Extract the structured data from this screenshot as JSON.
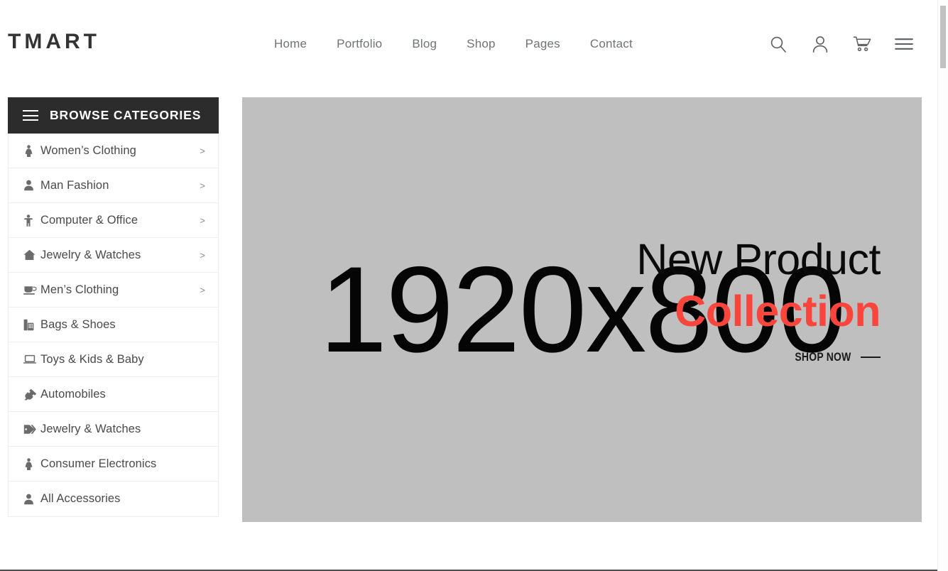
{
  "header": {
    "logo": "TMART",
    "nav": [
      {
        "label": "Home"
      },
      {
        "label": "Portfolio"
      },
      {
        "label": "Blog"
      },
      {
        "label": "Shop"
      },
      {
        "label": "Pages"
      },
      {
        "label": "Contact"
      }
    ],
    "icons": [
      {
        "name": "search-icon"
      },
      {
        "name": "user-account-icon"
      },
      {
        "name": "shopping-cart-icon"
      },
      {
        "name": "hamburger-menu-icon"
      }
    ]
  },
  "sidebar": {
    "title": "BROWSE CATEGORIES",
    "icon": "hamburger-menu-icon",
    "items": [
      {
        "label": "Women’s Clothing",
        "icon": "female-figure-icon",
        "arrow": ">",
        "has_arrow": true
      },
      {
        "label": "Man Fashion",
        "icon": "user-icon",
        "arrow": ">",
        "has_arrow": true
      },
      {
        "label": "Computer & Office",
        "icon": "child-figure-icon",
        "arrow": ">",
        "has_arrow": true
      },
      {
        "label": "Jewelry & Watches",
        "icon": "home-icon",
        "arrow": ">",
        "has_arrow": true
      },
      {
        "label": "Men’s Clothing",
        "icon": "coffee-cup-icon",
        "arrow": ">",
        "has_arrow": true
      },
      {
        "label": "Bags & Shoes",
        "icon": "fax-machine-icon",
        "arrow": "",
        "has_arrow": false
      },
      {
        "label": "Toys & Kids & Baby",
        "icon": "laptop-icon",
        "arrow": "",
        "has_arrow": false
      },
      {
        "label": "Automobiles",
        "icon": "power-plug-icon",
        "arrow": "",
        "has_arrow": false
      },
      {
        "label": "Jewelry & Watches",
        "icon": "price-tag-icon",
        "arrow": "",
        "has_arrow": false
      },
      {
        "label": "Consumer Electronics",
        "icon": "female-figure-icon",
        "arrow": "",
        "has_arrow": false
      },
      {
        "label": "All Accessories",
        "icon": "user-icon",
        "arrow": "",
        "has_arrow": false
      }
    ]
  },
  "hero": {
    "placeholder_text": "1920x800",
    "line1": "New Product",
    "line2": "Collection",
    "cta_label": "SHOP NOW",
    "background_color": "#bfbfbf",
    "accent_color": "#f9453b",
    "text_color": "#0a0a0a"
  }
}
